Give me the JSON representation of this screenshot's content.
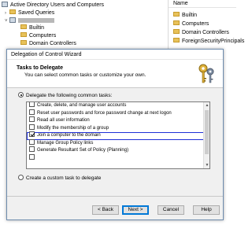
{
  "console": {
    "tree_items": [
      {
        "label": "Active Directory Users and Computers",
        "icon": "ad-console-icon"
      },
      {
        "label": "Saved Queries",
        "icon": "folder-icon"
      },
      {
        "label": "",
        "icon": "domain-icon",
        "redacted": true
      },
      {
        "label": "Builtin",
        "icon": "folder-icon"
      },
      {
        "label": "Computers",
        "icon": "folder-icon"
      },
      {
        "label": "Domain Controllers",
        "icon": "folder-icon"
      }
    ],
    "right_header": "Name",
    "right_items": [
      "Builtin",
      "Computers",
      "Domain Controllers",
      "ForeignSecurityPrincipals"
    ]
  },
  "wizard": {
    "title": "Delegation of Control Wizard",
    "header_title": "Tasks to Delegate",
    "header_subtitle": "You can select common tasks or customize your own.",
    "option_common": "Delegate the following common tasks:",
    "option_custom": "Create a custom task to delegate",
    "tasks": [
      {
        "label": "Create, delete, and manage user accounts",
        "checked": false
      },
      {
        "label": "Reset user passwords and force password change at next logon",
        "checked": false
      },
      {
        "label": "Read all user information",
        "checked": false
      },
      {
        "label": "Modify the membership of a group",
        "checked": false
      },
      {
        "label": "Join a computer to the domain",
        "checked": true,
        "highlighted": true
      },
      {
        "label": "Manage Group Policy links",
        "checked": false
      },
      {
        "label": "Generate Resultant Set of Policy (Planning)",
        "checked": false
      },
      {
        "label": "",
        "checked": false
      }
    ],
    "buttons": {
      "back": "< Back",
      "next": "Next >",
      "cancel": "Cancel",
      "help": "Help"
    }
  },
  "colors": {
    "highlight_border": "#1f2fd6",
    "dialog_bg": "#f0f0f0",
    "primary_button_border": "#0078d7"
  }
}
